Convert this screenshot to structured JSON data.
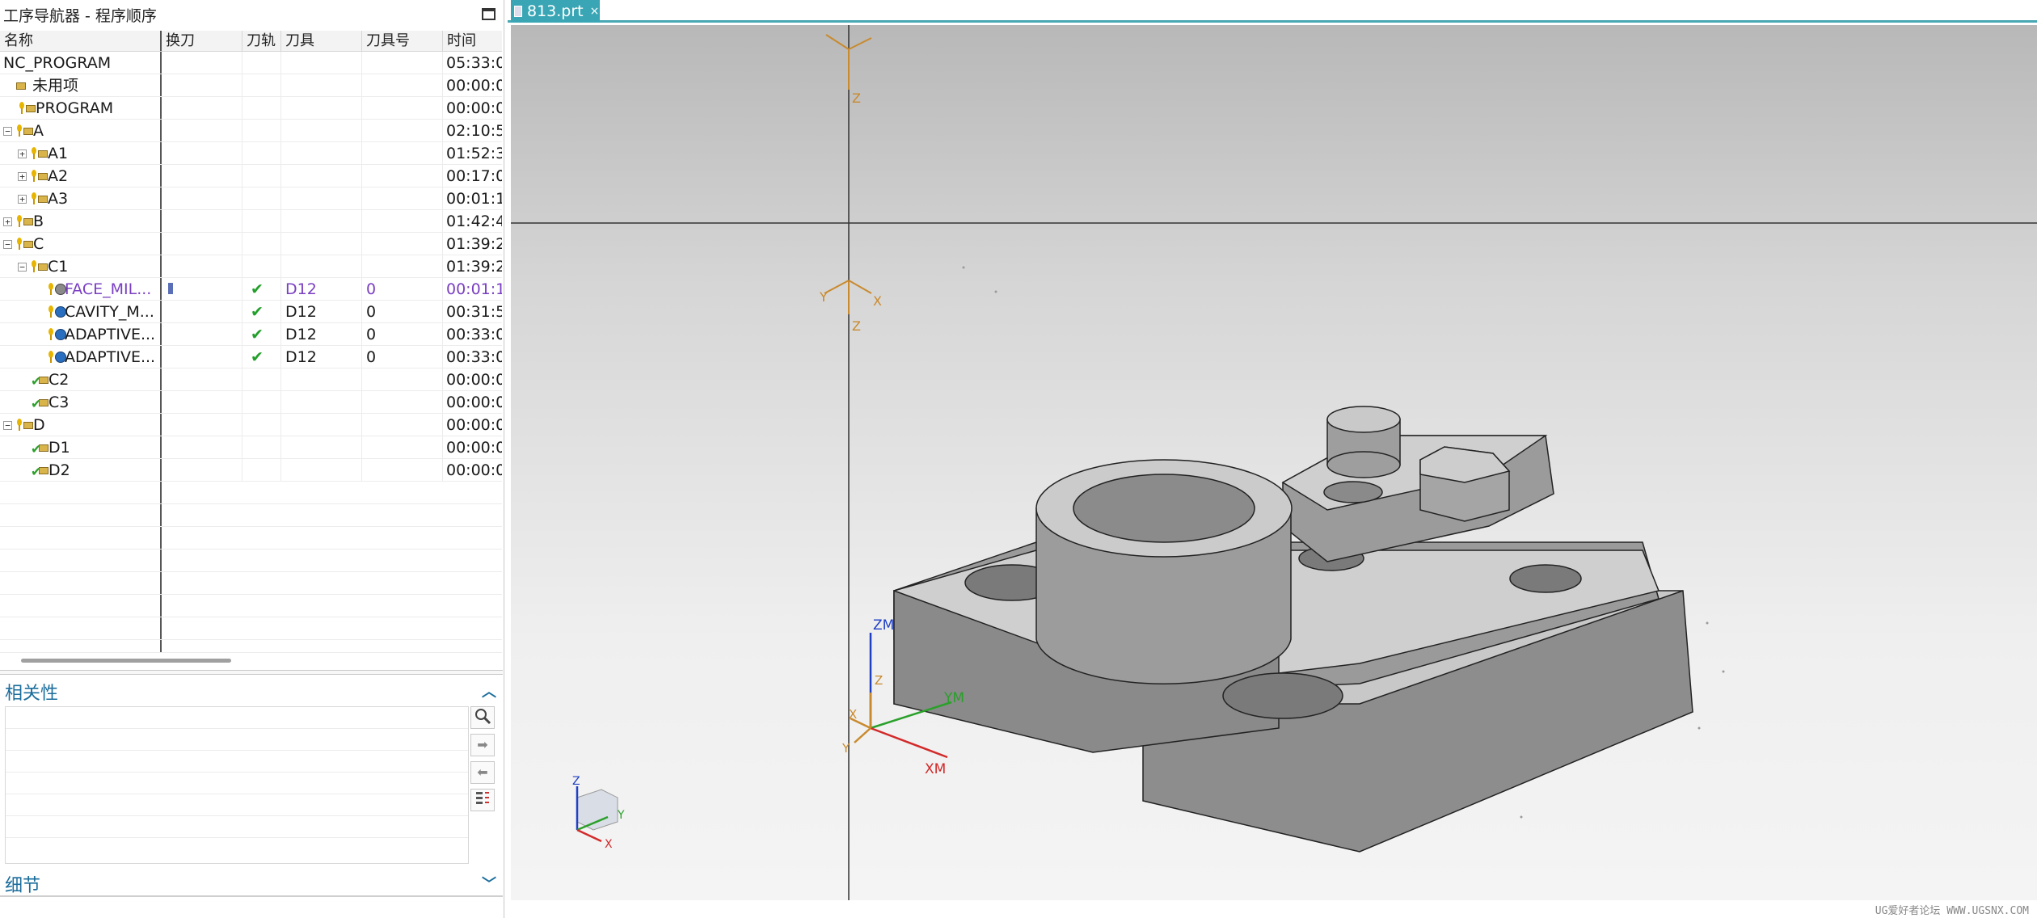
{
  "navigator": {
    "title": "工序导航器 - 程序顺序",
    "columns": {
      "name": "名称",
      "tool_change": "换刀",
      "toolpath": "刀轨",
      "tool": "刀具",
      "tool_number": "刀具号",
      "time": "时间"
    },
    "rows": [
      {
        "name": "NC_PROGRAM",
        "time": "05:33:0"
      },
      {
        "name": "未用项",
        "time": "00:00:0"
      },
      {
        "name": "PROGRAM",
        "time": "00:00:0"
      },
      {
        "name": "A",
        "time": "02:10:5"
      },
      {
        "name": "A1",
        "time": "01:52:3"
      },
      {
        "name": "A2",
        "time": "00:17:0"
      },
      {
        "name": "A3",
        "time": "00:01:1"
      },
      {
        "name": "B",
        "time": "01:42:4"
      },
      {
        "name": "C",
        "time": "01:39:2"
      },
      {
        "name": "C1",
        "time": "01:39:2"
      },
      {
        "name": "FACE_MIL...",
        "toolpath": "✔",
        "tool": "D12",
        "tool_number": "0",
        "time": "00:01:1"
      },
      {
        "name": "CAVITY_M...",
        "toolpath": "✔",
        "tool": "D12",
        "tool_number": "0",
        "time": "00:31:5"
      },
      {
        "name": "ADAPTIVE...",
        "toolpath": "✔",
        "tool": "D12",
        "tool_number": "0",
        "time": "00:33:0"
      },
      {
        "name": "ADAPTIVE...",
        "toolpath": "✔",
        "tool": "D12",
        "tool_number": "0",
        "time": "00:33:0"
      },
      {
        "name": "C2",
        "time": "00:00:0"
      },
      {
        "name": "C3",
        "time": "00:00:0"
      },
      {
        "name": "D",
        "time": "00:00:0"
      },
      {
        "name": "D1",
        "time": "00:00:0"
      },
      {
        "name": "D2",
        "time": "00:00:0"
      }
    ]
  },
  "relevance": {
    "title": "相关性"
  },
  "details": {
    "title": "细节"
  },
  "tab": {
    "label": "813.prt",
    "close": "×"
  },
  "viewport": {
    "wcs_labels": {
      "x": "X",
      "y": "Y",
      "z": "Z"
    },
    "mcs_labels": {
      "xm": "XM",
      "ym": "YM",
      "zm": "ZM"
    }
  },
  "watermark": "UG爱好者论坛 WWW.UGSNX.COM",
  "colors": {
    "accent": "#3aa6b5",
    "section_title": "#1b6d9c",
    "selected_text": "#7a3fc2"
  }
}
